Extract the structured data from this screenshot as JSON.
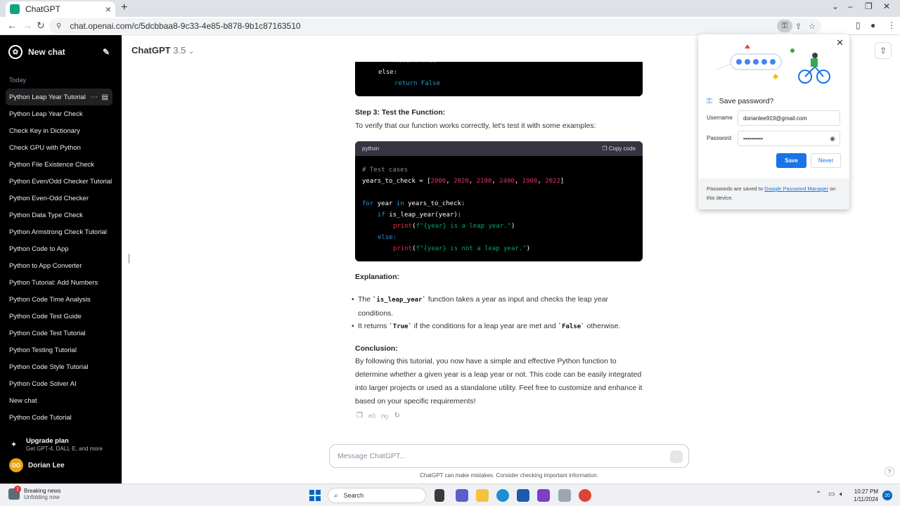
{
  "browser": {
    "tab_title": "ChatGPT",
    "url": "chat.openai.com/c/5dcbbaa8-9c33-4e85-b878-9b1c87163510"
  },
  "sidebar": {
    "new_chat": "New chat",
    "section_today": "Today",
    "chats": [
      "Python Leap Year Tutorial",
      "Python Leap Year Check",
      "Check Key in Dictionary",
      "Check GPU with Python",
      "Python File Existence Check",
      "Python Even/Odd Checker Tutorial",
      "Python Even-Odd Checker",
      "Python Data Type Check",
      "Python Armstrong Check Tutorial",
      "Python Code to App",
      "Python to App Converter",
      "Python Tutorial: Add Numbers",
      "Python Code Time Analysis",
      "Python Code Test Guide",
      "Python Code Test Tutorial",
      "Python Testing Tutorial",
      "Python Code Style Tutorial",
      "Python Code Solver AI",
      "New chat",
      "Python Code Tutorial"
    ],
    "upgrade_title": "Upgrade plan",
    "upgrade_sub": "Get GPT-4, DALL·E, and more",
    "user_initials": "DO",
    "user_name": "Dorian Lee"
  },
  "main": {
    "model_name": "ChatGPT",
    "model_version": "3.5",
    "code_top": {
      "line1": "return True",
      "line2": "else:",
      "line3": "return False"
    },
    "step3_heading": "Step 3: Test the Function:",
    "step3_text": "To verify that our function works correctly, let's test it with some examples:",
    "code_block": {
      "language": "python",
      "copy_label": "Copy code",
      "comment": "# Test cases",
      "years_var": "years_to_check = [",
      "years": [
        "2000",
        "2020",
        "2100",
        "2400",
        "1900",
        "2022"
      ],
      "for_kw": "for",
      "for_var": "year",
      "in_kw": "in",
      "for_rest": "years_to_check:",
      "if_kw": "if",
      "if_rest": "is_leap_year(year):",
      "print1_fn": "print",
      "print1_str": "f\"{year} is a leap year.\"",
      "else_kw": "else:",
      "print2_fn": "print",
      "print2_str": "f\"{year} is not a leap year.\""
    },
    "explanation_heading": "Explanation:",
    "bullet1_pre": "The ",
    "bullet1_code": "`is_leap_year`",
    "bullet1_post": " function takes a year as input and checks the leap year conditions.",
    "bullet2_pre": "It returns ",
    "bullet2_code1": "`True`",
    "bullet2_mid": " if the conditions for a leap year are met and ",
    "bullet2_code2": "`False`",
    "bullet2_post": " otherwise.",
    "conclusion_heading": "Conclusion:",
    "conclusion_text": "By following this tutorial, you now have a simple and effective Python function to determine whether a given year is a leap year or not. This code can be easily integrated into larger projects or used as a standalone utility. Feel free to customize and enhance it based on your specific requirements!",
    "input_placeholder": "Message ChatGPT...",
    "disclaimer": "ChatGPT can make mistakes. Consider checking important information.",
    "help": "?"
  },
  "password_popup": {
    "title": "Save password?",
    "username_label": "Username",
    "username_value": "dorianlee919@gmail.com",
    "password_label": "Password",
    "password_value": "••••••••••",
    "save_label": "Save",
    "never_label": "Never",
    "footer_pre": "Passwords are saved to ",
    "footer_link": "Google Password Manager",
    "footer_post": " on this device."
  },
  "taskbar": {
    "news_title": "Breaking news",
    "news_sub": "Unfolding now",
    "news_badge": "1",
    "search_label": "Search",
    "time": "10:27 PM",
    "date": "1/11/2024",
    "notif_count": "20"
  },
  "colors": {
    "accent": "#1a73e8",
    "sidebar_bg": "#000000",
    "code_keyword": "#2e95d3",
    "code_number": "#df3079",
    "code_string": "#00a67d"
  }
}
